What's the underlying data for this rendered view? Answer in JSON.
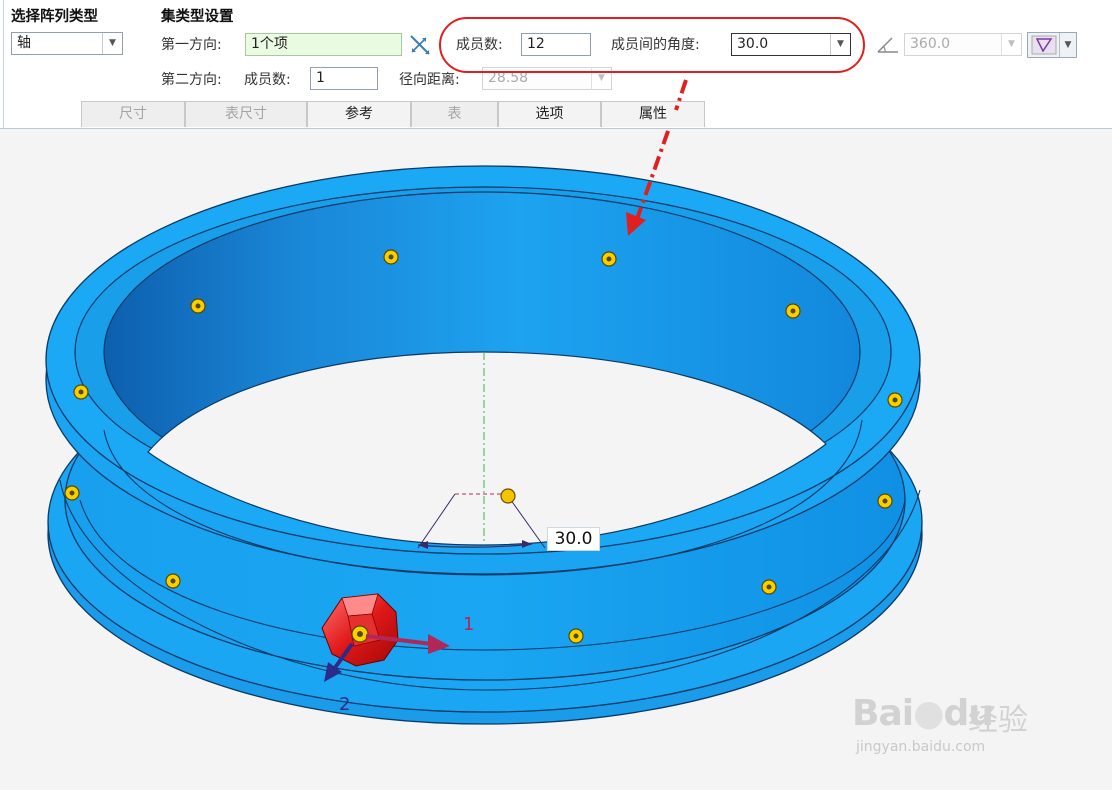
{
  "ribbon": {
    "pattern_type_title": "选择阵列类型",
    "pattern_type_value": "轴",
    "set_type_title": "集类型设置",
    "first_direction_label": "第一方向:",
    "first_direction_value": "1个项",
    "members_label": "成员数:",
    "members_value": "12",
    "angle_between_label": "成员间的角度:",
    "angle_between_value": "30.0",
    "total_angle_value": "360.0",
    "second_direction_label": "第二方向:",
    "second_members_label": "成员数:",
    "second_members_value": "1",
    "radial_distance_label": "径向距离:",
    "radial_distance_value": "28.58"
  },
  "tabs": [
    {
      "label": "尺寸",
      "enabled": false
    },
    {
      "label": "表尺寸",
      "enabled": false
    },
    {
      "label": "参考",
      "enabled": true
    },
    {
      "label": "表",
      "enabled": false
    },
    {
      "label": "选项",
      "enabled": true
    },
    {
      "label": "属性",
      "enabled": true
    }
  ],
  "viewport": {
    "dimension_value": "30.0",
    "direction_label_1": "1",
    "direction_label_2": "2"
  },
  "watermark": {
    "url": "jingyan.baidu.com"
  },
  "colors": {
    "model_blue": "#1aa3f0",
    "annotation_red": "#e02020",
    "highlight_green": "#e9fbe0"
  }
}
